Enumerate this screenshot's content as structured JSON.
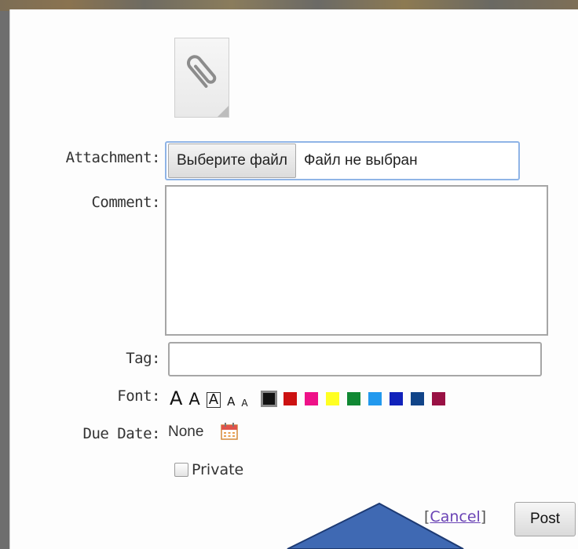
{
  "form": {
    "attachment_label": "Attachment:",
    "file_button_label": "Выберите файл",
    "file_status": "Файл не выбран",
    "comment_label": "Comment:",
    "comment_value": "",
    "tag_label": "Tag:",
    "tag_value": "",
    "font_label": "Font:",
    "font_sizes": [
      "A",
      "A",
      "A",
      "A",
      "A"
    ],
    "colors": [
      "#111111",
      "#cc1111",
      "#ee1188",
      "#ffff22",
      "#118833",
      "#2299ee",
      "#1122bb",
      "#114488",
      "#991144"
    ],
    "due_date_label": "Due Date:",
    "due_date_value": "None",
    "private_label": "Private",
    "cancel_open": "[",
    "cancel_label": "Cancel",
    "cancel_close": "]",
    "post_label": "Post"
  },
  "icons": {
    "attachment": "paperclip-icon",
    "calendar": "calendar-icon"
  },
  "overlay": {
    "arrow_color": "#3f69b3"
  }
}
